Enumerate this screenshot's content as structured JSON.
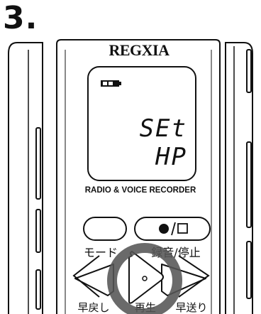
{
  "step_number": "3.",
  "device": {
    "brand": "REGXIA",
    "model_text": "RADIO & VOICE RECORDER",
    "display": {
      "battery_icon": "battery-icon",
      "line1": "SEt",
      "line2": "HP"
    },
    "buttons": {
      "mode_label": "モード",
      "record_stop_symbol": "●/□",
      "record_stop_label": "録音/停止",
      "rewind_label": "早戻し",
      "play_label": "再生",
      "fast_forward_label": "早送り"
    },
    "highlight": "play-button"
  }
}
